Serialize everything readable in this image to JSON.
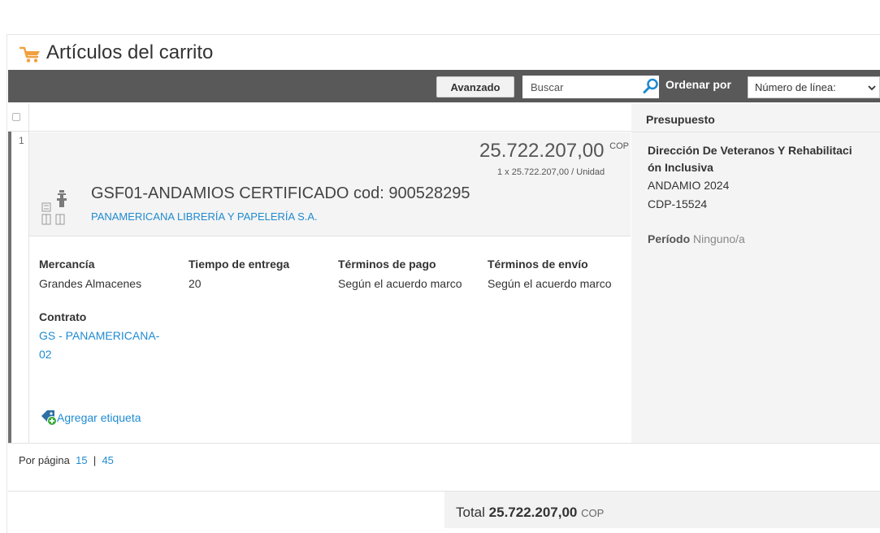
{
  "page": {
    "title": "Artículos del carrito",
    "icon": "shopping-cart-icon"
  },
  "toolbar": {
    "advanced_label": "Avanzado",
    "search_placeholder": "Buscar",
    "sort_label": "Ordenar por",
    "sort_selected": "Número de línea: "
  },
  "table": {
    "budget_header": "Presupuesto"
  },
  "item": {
    "line_number": "1",
    "price": "25.722.207,00",
    "currency": "COP",
    "price_detail": "1 x 25.722.207,00 / Unidad",
    "name": "GSF01-ANDAMIOS CERTIFICADO cod: 900528295",
    "supplier": "PANAMERICANA LIBRERÍA Y PAPELERÍA S.A.",
    "fields": {
      "merchandise_label": "Mercancía",
      "merchandise_value": "Grandes Almacenes",
      "delivery_label": "Tiempo de entrega",
      "delivery_value": "20",
      "payment_label": "Términos de pago",
      "payment_value": "Según el acuerdo marco",
      "shipping_label": "Términos de envío",
      "shipping_value": "Según el acuerdo marco",
      "contract_label": "Contrato",
      "contract_line1": "GS - PANAMERICANA-",
      "contract_line2": "02"
    },
    "add_tag_label": "Agregar etiqueta"
  },
  "budget": {
    "line1": "Dirección De Veteranos Y Rehabilitaci",
    "line2": "ón Inclusiva",
    "line3": "ANDAMIO 2024",
    "line4": "CDP-15524",
    "period_label": "Período",
    "period_value": "Ninguno/a"
  },
  "pagination": {
    "label": "Por página",
    "option1": "15",
    "separator": "|",
    "option2": "45"
  },
  "total": {
    "label": "Total",
    "value": "25.722.207,00",
    "currency": "COP"
  },
  "colors": {
    "toolbar_bg": "#595959",
    "link": "#1f8bd1",
    "accent_orange": "#f0a040"
  }
}
